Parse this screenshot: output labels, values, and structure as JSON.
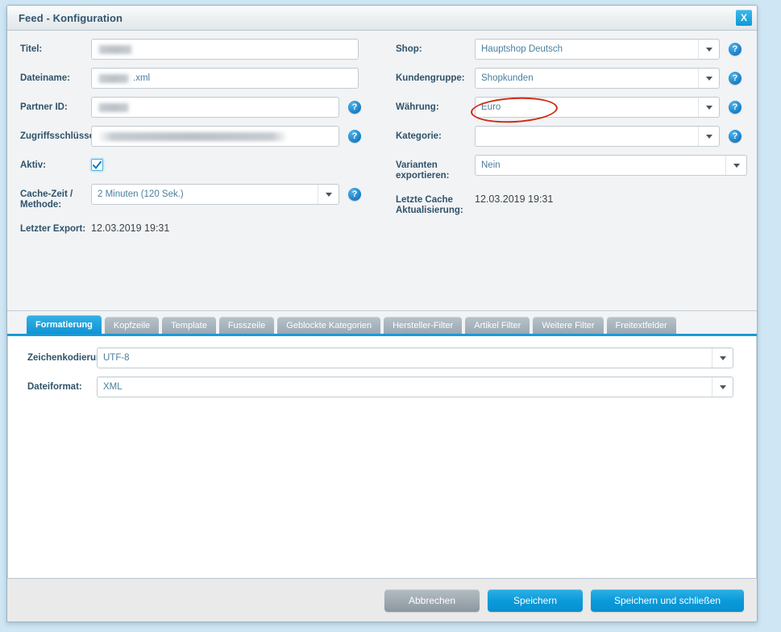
{
  "window": {
    "title": "Feed - Konfiguration",
    "close_label": "X",
    "close_icon": "close-icon"
  },
  "theme": {
    "page_background": "#cfe6f4",
    "dialog_background": "#f1f3f5",
    "accent_blue": "#1b9ad8",
    "label_color": "#2f5269",
    "field_text_color": "#4a7e9e",
    "annotation_color": "#cf2a16",
    "footer_background": "#eaeaea"
  },
  "form": {
    "left_column": [
      {
        "label": "Titel:",
        "value": "",
        "redacted": true,
        "control": "text",
        "help": false
      },
      {
        "label": "Dateiname:",
        "value": ".xml",
        "redacted": true,
        "control": "text",
        "help": false
      },
      {
        "label": "Partner ID:",
        "value": "",
        "redacted": true,
        "control": "text",
        "help": true
      },
      {
        "label": "Zugriffsschlüssel:",
        "value": "",
        "redacted": true,
        "control": "text",
        "help": true
      },
      {
        "label": "Aktiv:",
        "value": "checked",
        "redacted": false,
        "control": "checkbox",
        "help": false
      },
      {
        "label": "Cache-Zeit / Methode:",
        "value": "2 Minuten (120 Sek.)",
        "redacted": false,
        "control": "select",
        "help": true
      },
      {
        "label": "Letzter Export:",
        "value": "12.03.2019 19:31",
        "redacted": false,
        "control": "static",
        "help": false
      }
    ],
    "right_column": [
      {
        "label": "Shop:",
        "value": "Hauptshop Deutsch",
        "control": "select",
        "help": true,
        "highlighted": false
      },
      {
        "label": "Kundengruppe:",
        "value": "Shopkunden",
        "control": "select",
        "help": true,
        "highlighted": true
      },
      {
        "label": "Währung:",
        "value": "Euro",
        "control": "select",
        "help": true,
        "highlighted": false
      },
      {
        "label": "Kategorie:",
        "value": "",
        "control": "select",
        "help": true,
        "highlighted": false
      },
      {
        "label": "Varianten exportieren:",
        "value": "Nein",
        "control": "select-wide",
        "help": false,
        "highlighted": false
      },
      {
        "label": "Letzte Cache Aktualisierung:",
        "value": "12.03.2019 19:31",
        "control": "static",
        "help": false,
        "highlighted": false
      }
    ],
    "field_suffix_dateiname": ".xml"
  },
  "tabs": {
    "active_index": 0,
    "items": [
      {
        "label": "Formatierung"
      },
      {
        "label": "Kopfzeile"
      },
      {
        "label": "Template"
      },
      {
        "label": "Fusszeile"
      },
      {
        "label": "Geblockte Kategorien"
      },
      {
        "label": "Hersteller-Filter"
      },
      {
        "label": "Artikel Filter"
      },
      {
        "label": "Weitere Filter"
      },
      {
        "label": "Freitextfelder"
      }
    ]
  },
  "panel": {
    "fields": [
      {
        "label": "Zeichenkodierung:",
        "value": "UTF-8"
      },
      {
        "label": "Dateiformat:",
        "value": "XML"
      }
    ]
  },
  "footer": {
    "buttons": [
      {
        "label": "Abbrechen",
        "style": "grey"
      },
      {
        "label": "Speichern",
        "style": "blue"
      },
      {
        "label": "Speichern und schließen",
        "style": "blue"
      }
    ]
  },
  "icons": {
    "help": "?",
    "dropdown": "chevron-down-icon",
    "check": "check-icon"
  }
}
